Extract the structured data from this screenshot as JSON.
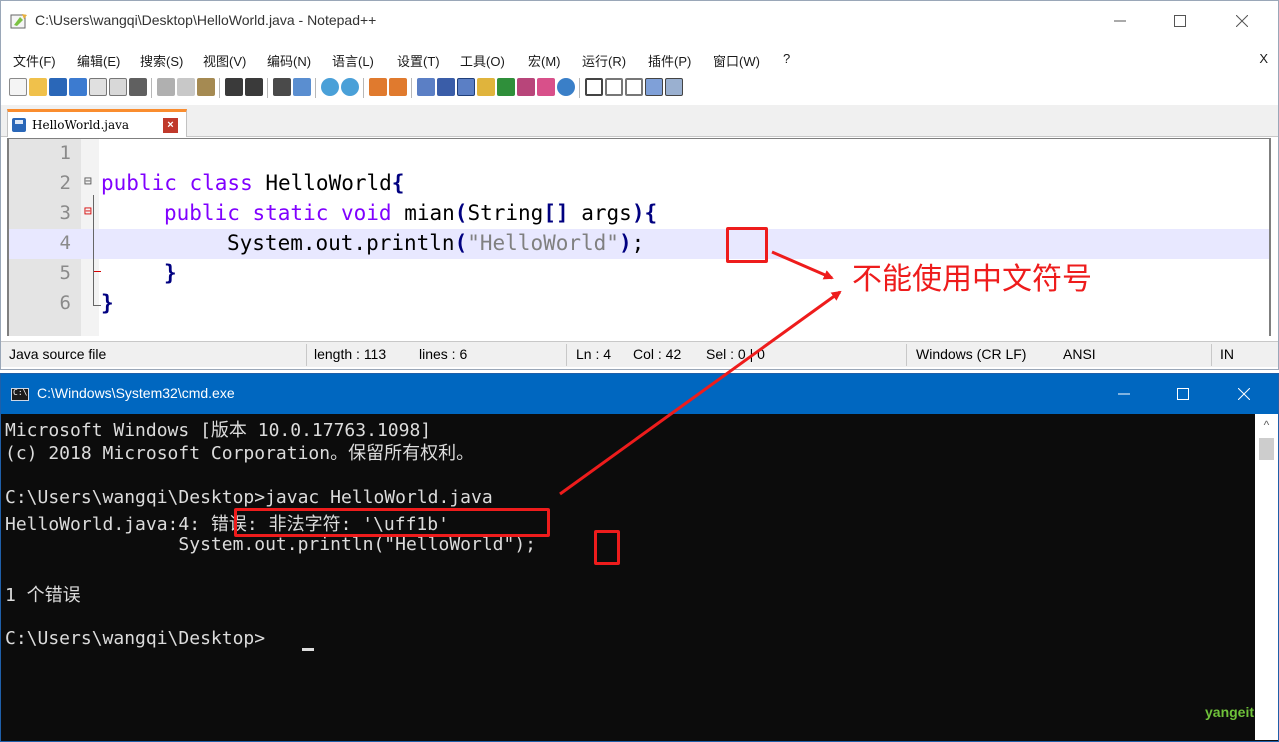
{
  "notepad": {
    "title": "C:\\Users\\wangqi\\Desktop\\HelloWorld.java - Notepad++",
    "menu": [
      "文件(F)",
      "编辑(E)",
      "搜索(S)",
      "视图(V)",
      "编码(N)",
      "语言(L)",
      "设置(T)",
      "工具(O)",
      "宏(M)",
      "运行(R)",
      "插件(P)",
      "窗口(W)",
      "?"
    ],
    "menu_close": "X",
    "tab_label": "HelloWorld.java",
    "tab_close": "×",
    "line_numbers": [
      "1",
      "2",
      "3",
      "4",
      "5",
      "6"
    ],
    "code": {
      "l2_kw": "public class",
      "l2_name": " HelloWorld",
      "l2_brace": "{",
      "l3_kw": "public static void",
      "l3_name": " mian",
      "l3_paren": "(",
      "l3_type": "String",
      "l3_bracket": "[]",
      "l3_args": " args",
      "l3_close": "){",
      "l4_call": "System.out.println",
      "l4_open": "(",
      "l4_str": "\"HelloWorld\"",
      "l4_close": ")",
      "l4_semi": ";",
      "l5_brace": "}",
      "l6_brace": "}"
    },
    "status": {
      "file_type": "Java source file",
      "length": "length : 113",
      "lines": "lines : 6",
      "ln": "Ln : 4",
      "col": "Col : 42",
      "sel": "Sel : 0 | 0",
      "eol": "Windows (CR LF)",
      "encoding": "ANSI",
      "mode": "IN"
    }
  },
  "console": {
    "title": "C:\\Windows\\System32\\cmd.exe",
    "lines": [
      "Microsoft Windows [版本 10.0.17763.1098]",
      "(c) 2018 Microsoft Corporation。保留所有权利。",
      "C:\\Users\\wangqi\\Desktop>javac HelloWorld.java",
      "HelloWorld.java:4: 错误: 非法字符: '\\uff1b'",
      "                System.out.println(\"HelloWorld\");",
      "1 个错误",
      "C:\\Users\\wangqi\\Desktop>"
    ]
  },
  "annotation": {
    "text": "不能使用中文符号",
    "color": "#ee1c1c"
  },
  "watermark": "yangeit",
  "colors": {
    "keyword": "#8000ff",
    "operator": "#000080",
    "string": "#808080",
    "current_line": "#e8e8ff",
    "cmd_title": "#0067c0",
    "tab_accent": "#fa8d2f"
  }
}
